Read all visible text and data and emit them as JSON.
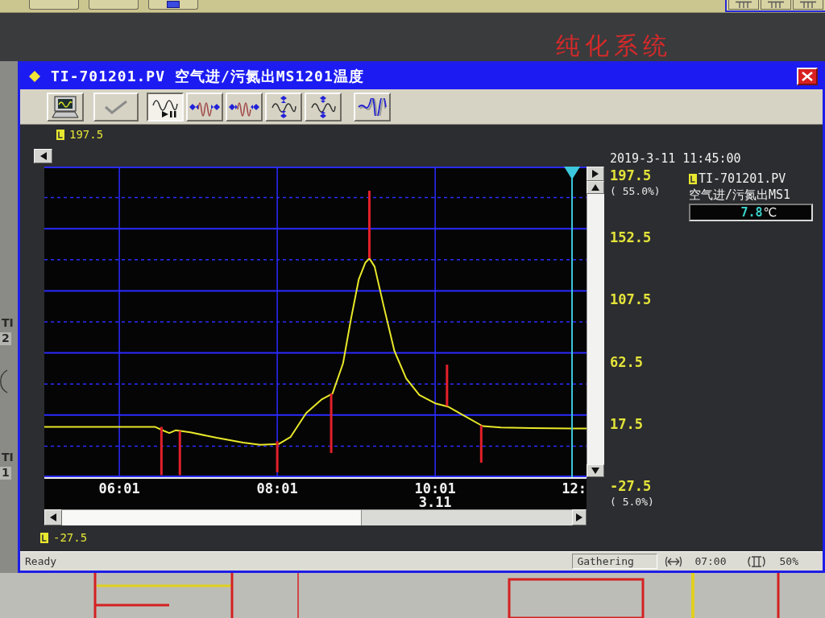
{
  "backdrop": {
    "heading": "纯化系统",
    "side_labels": [
      "TI",
      "2",
      "TI",
      "1"
    ]
  },
  "window": {
    "title": "TI-701201.PV 空气进/污氮出MS1201温度",
    "toolbar": [
      {
        "kind": "monitor",
        "pressed": false
      },
      {
        "kind": "check",
        "pressed": false
      },
      {
        "kind": "play",
        "pressed": true
      },
      {
        "kind": "stretch_time",
        "pressed": false
      },
      {
        "kind": "shrink_time",
        "pressed": false
      },
      {
        "kind": "stretch_value",
        "pressed": false
      },
      {
        "kind": "shrink_value",
        "pressed": false
      },
      {
        "kind": "trend",
        "pressed": false
      }
    ]
  },
  "trend": {
    "range_high": "197.5",
    "range_low": "-27.5",
    "timestamp": "2019-3-11 11:45:00",
    "high_percent": "( 55.0%)",
    "low_percent": "( 5.0%)",
    "axis_end_label": "12:",
    "chart_data": {
      "type": "line",
      "x": [
        304,
        330,
        360,
        388,
        395,
        399,
        404,
        415,
        435,
        455,
        468,
        482,
        491,
        503,
        515,
        523,
        531,
        537,
        543,
        548,
        551,
        555,
        562,
        570,
        579,
        589,
        601,
        611,
        623,
        637,
        651,
        675,
        705,
        716
      ],
      "series": [
        {
          "name": "TI-701201.PV",
          "color": "#e8e82a",
          "values": [
            9,
            9,
            9,
            9,
            6,
            4.5,
            6.5,
            5,
            1,
            -2.5,
            -4,
            -3.5,
            1.5,
            19,
            29,
            33,
            55,
            87,
            116,
            128,
            131,
            125,
            96,
            64,
            44,
            32,
            26,
            23.5,
            17,
            9.5,
            8.5,
            8,
            7.8,
            7.8
          ]
        }
      ],
      "xlim": [
        304,
        716
      ],
      "ylim": [
        -27.5,
        197.5
      ],
      "xticks": [
        {
          "value": 361,
          "label": "06:01"
        },
        {
          "value": 481,
          "label": "08:01"
        },
        {
          "value": 601,
          "label": "10:01"
        }
      ],
      "yticks": [
        -27.5,
        17.5,
        62.5,
        107.5,
        152.5,
        197.5
      ],
      "grid": true,
      "ref_lines": [
        {
          "axis": "y",
          "value": -5
        },
        {
          "axis": "y",
          "value": 40
        },
        {
          "axis": "y",
          "value": 85
        },
        {
          "axis": "y",
          "value": 130
        },
        {
          "axis": "y",
          "value": 175
        },
        {
          "axis": "x",
          "value": 705
        }
      ],
      "annotations": [
        "3.11"
      ]
    }
  },
  "legend": {
    "description": "空气进/污氮出MS1",
    "value": "7.8",
    "unit": "℃"
  },
  "status_bar": {
    "message": "Ready",
    "mode": "Gathering",
    "span": "07:00",
    "zoom": "50%"
  }
}
